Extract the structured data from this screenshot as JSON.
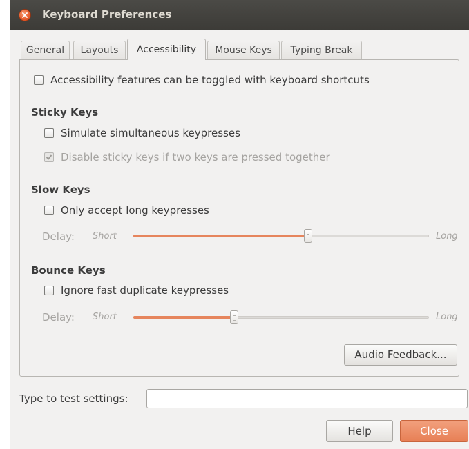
{
  "window": {
    "title": "Keyboard Preferences"
  },
  "tabs": [
    {
      "label": "General",
      "active": false
    },
    {
      "label": "Layouts",
      "active": false
    },
    {
      "label": "Accessibility",
      "active": true
    },
    {
      "label": "Mouse Keys",
      "active": false
    },
    {
      "label": "Typing Break",
      "active": false
    }
  ],
  "accessibility": {
    "toggle_label": "Accessibility features can be toggled with keyboard shortcuts",
    "toggle_checked": false
  },
  "sticky_keys": {
    "heading": "Sticky Keys",
    "simulate_label": "Simulate simultaneous keypresses",
    "simulate_checked": false,
    "disable_label": "Disable sticky keys if two keys are pressed together",
    "disable_checked": true,
    "disable_enabled": false
  },
  "slow_keys": {
    "heading": "Slow Keys",
    "long_label": "Only accept long keypresses",
    "long_checked": false,
    "delay_label": "Delay:",
    "short_label": "Short",
    "long_end_label": "Long",
    "delay_fraction": 0.59
  },
  "bounce_keys": {
    "heading": "Bounce Keys",
    "ignore_label": "Ignore fast duplicate keypresses",
    "ignore_checked": false,
    "delay_label": "Delay:",
    "short_label": "Short",
    "long_end_label": "Long",
    "delay_fraction": 0.34
  },
  "buttons": {
    "audio_feedback": "Audio Feedback...",
    "help": "Help",
    "close": "Close"
  },
  "test": {
    "label": "Type to test settings:",
    "value": "",
    "placeholder": ""
  },
  "colors": {
    "accent": "#e77f55",
    "titlebar": "#3c3b37",
    "window_bg": "#f2f1f0"
  }
}
